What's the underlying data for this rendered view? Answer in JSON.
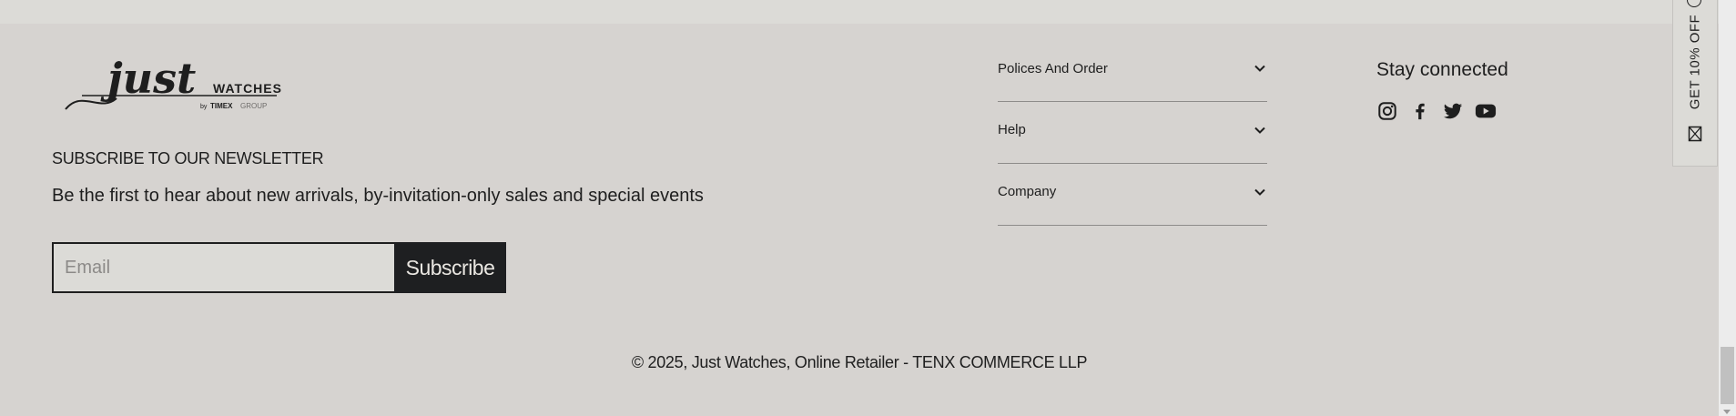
{
  "brand": {
    "logo_script": "just",
    "logo_word": "WATCHES",
    "logo_by": "by",
    "logo_timex": "TIMEX",
    "logo_group": "GROUP"
  },
  "newsletter": {
    "heading": "SUBSCRIBE TO OUR NEWSLETTER",
    "text": "Be the first to hear about new arrivals, by-invitation-only sales and special events",
    "email_placeholder": "Email",
    "subscribe_label": "Subscribe"
  },
  "footer_menu": [
    {
      "label": "Polices And Order"
    },
    {
      "label": "Help"
    },
    {
      "label": "Company"
    }
  ],
  "social": {
    "heading": "Stay connected",
    "icons": [
      "instagram-icon",
      "facebook-icon",
      "twitter-icon",
      "youtube-icon"
    ]
  },
  "copyright": "© 2025, Just Watches, Online Retailer - TENX COMMERCE LLP",
  "promo_tab": {
    "label": "GET 10% OFF"
  },
  "colors": {
    "background": "#d6d3d0",
    "button": "#1e1f21",
    "text": "#1e1e1e"
  }
}
